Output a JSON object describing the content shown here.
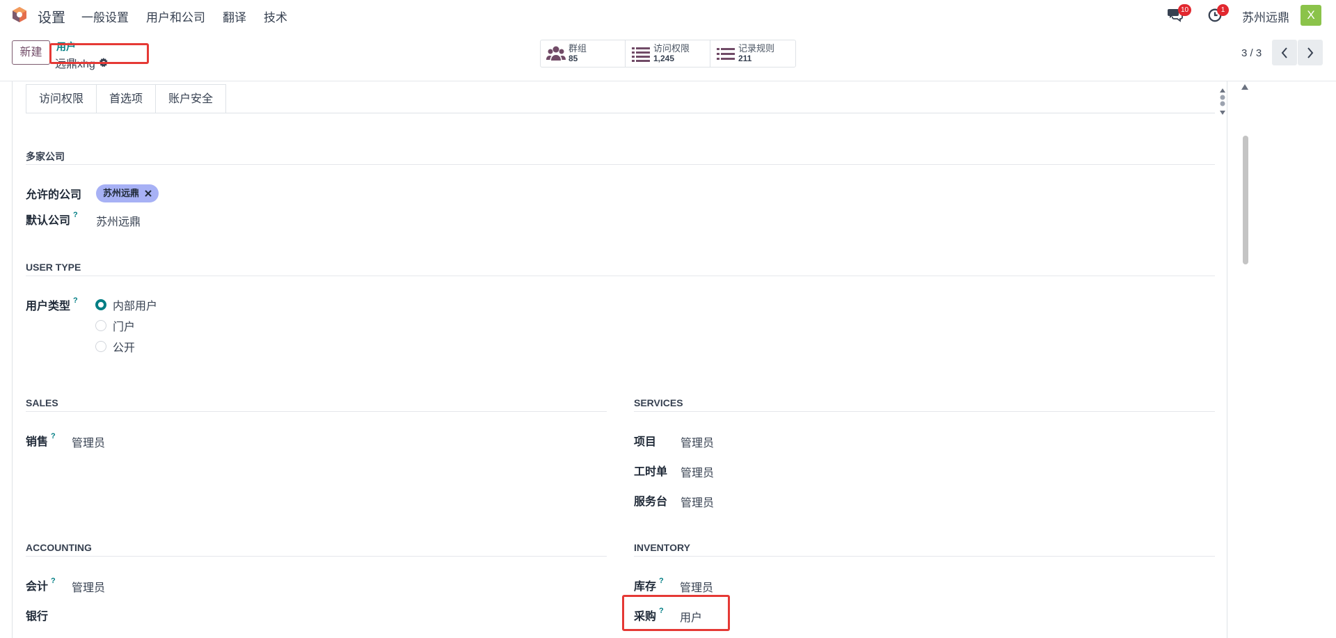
{
  "navbar": {
    "app_name": "设置",
    "menu": [
      "一般设置",
      "用户和公司",
      "翻译",
      "技术"
    ],
    "messages_count": "10",
    "activities_count": "1",
    "company": "苏州远鼎",
    "avatar_letter": "X"
  },
  "control_panel": {
    "new_button": "新建",
    "breadcrumb_parent": "用户",
    "breadcrumb_current": "远鼎xhg",
    "stats": [
      {
        "label": "群组",
        "value": "85",
        "icon": "users-icon"
      },
      {
        "label": "访问权限",
        "value": "1,245",
        "icon": "list-icon"
      },
      {
        "label": "记录规则",
        "value": "211",
        "icon": "list-icon"
      }
    ],
    "pager": "3 / 3"
  },
  "tabs": [
    "访问权限",
    "首选项",
    "账户安全"
  ],
  "sections": {
    "multi_company": {
      "title": "多家公司",
      "allowed_label": "允许的公司",
      "allowed_tag": "苏州远鼎",
      "default_label": "默认公司",
      "default_value": "苏州远鼎"
    },
    "user_type": {
      "title": "USER TYPE",
      "label": "用户类型",
      "options": [
        "内部用户",
        "门户",
        "公开"
      ],
      "selected": "内部用户"
    },
    "sales": {
      "title": "SALES",
      "label": "销售",
      "value": "管理员"
    },
    "services": {
      "title": "SERVICES",
      "rows": [
        {
          "label": "项目",
          "value": "管理员"
        },
        {
          "label": "工时单",
          "value": "管理员"
        },
        {
          "label": "服务台",
          "value": "管理员"
        }
      ]
    },
    "accounting": {
      "title": "ACCOUNTING",
      "rows": [
        {
          "label": "会计",
          "value": "管理员"
        },
        {
          "label": "银行",
          "value": ""
        }
      ]
    },
    "inventory": {
      "title": "INVENTORY",
      "rows": [
        {
          "label": "库存",
          "value": "管理员"
        },
        {
          "label": "采购",
          "value": "用户"
        }
      ]
    }
  },
  "colors": {
    "brand": "#714b67",
    "link": "#017e84",
    "highlight_box": "#e53935",
    "tag_bg": "#a7b1f5",
    "avatar_bg": "#8bc34a"
  }
}
